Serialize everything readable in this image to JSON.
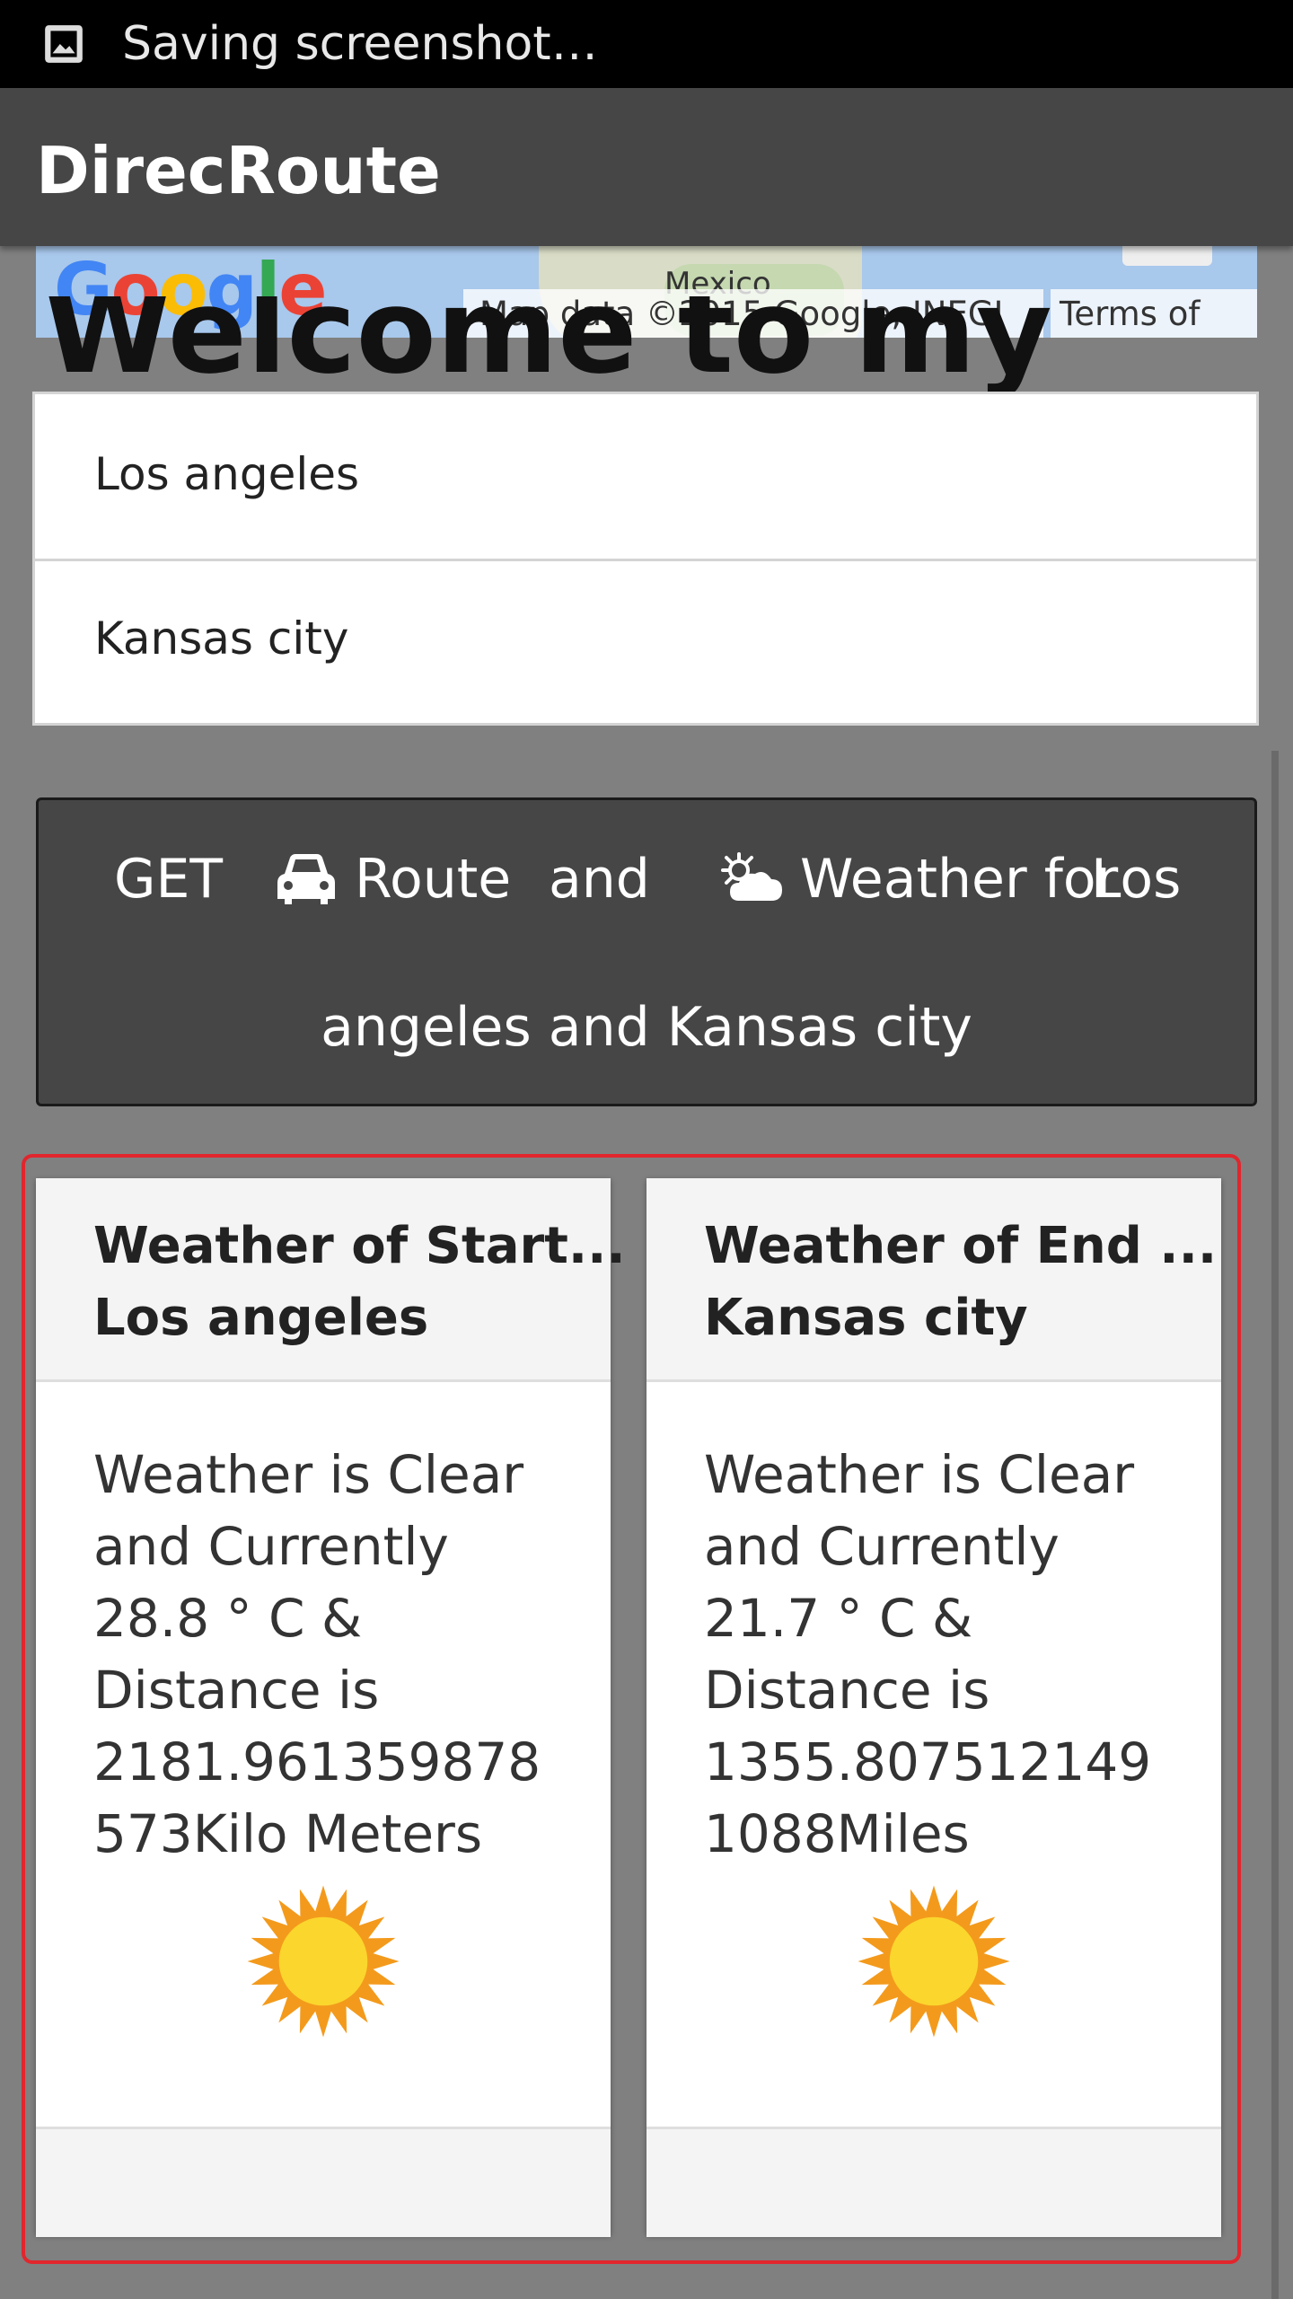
{
  "status_bar": {
    "text": "Saving screenshot…"
  },
  "app_bar": {
    "title": "DirecRoute"
  },
  "map": {
    "country_label": "Mexico",
    "gulf_label": "Gulf of Mexico",
    "attribution": "Map data ©2015 Google, INEGI",
    "terms": "Terms of Use",
    "logo": "Google"
  },
  "welcome": {
    "text": "Welcome to my"
  },
  "form": {
    "start_value": "Los angeles",
    "end_value": "Kansas city"
  },
  "action_button": {
    "get": "GET",
    "route": "Route",
    "and": "and",
    "weather_for": "Weather for",
    "los": "Los",
    "line2": "angeles and Kansas city",
    "car_icon": "car-icon",
    "weather_icon": "partly-cloudy-icon"
  },
  "cards": [
    {
      "title": "Weather of Start...",
      "city": "Los angeles",
      "lines": [
        "Weather is Clear",
        "and Currently",
        "28.8 ° C &",
        "Distance is",
        "2181.961359878",
        "573Kilo Meters"
      ],
      "icon": "sun-icon"
    },
    {
      "title": "Weather of End ...",
      "city": "Kansas city",
      "lines": [
        "Weather is Clear",
        "and Currently",
        "21.7 ° C &",
        "Distance is",
        "1355.807512149",
        "1088Miles"
      ],
      "icon": "sun-icon"
    }
  ],
  "colors": {
    "background": "#808080",
    "app_bar": "#464646",
    "highlight_outline": "#e1262d"
  }
}
